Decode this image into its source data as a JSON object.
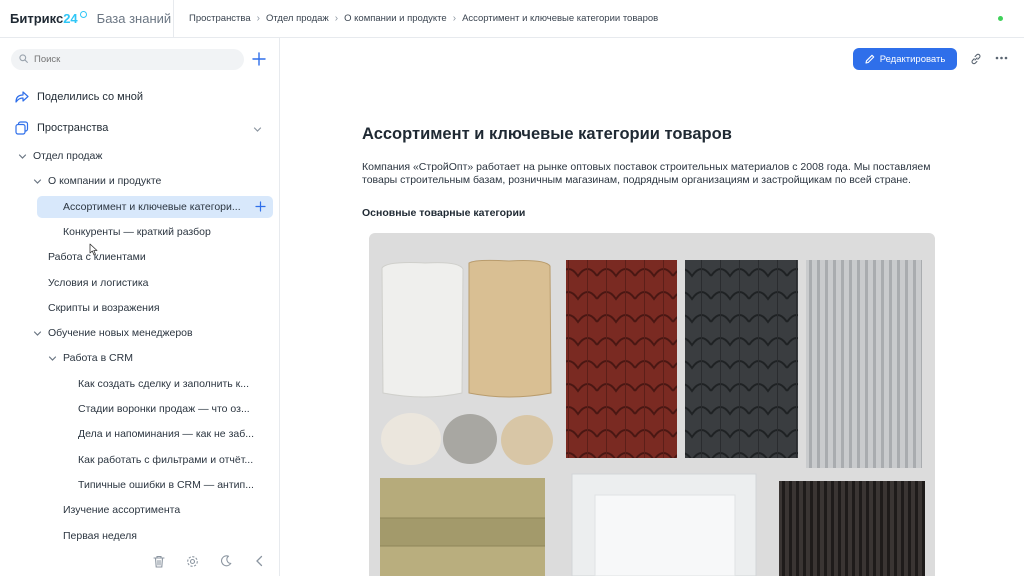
{
  "brand": {
    "name": "Битрикс",
    "number": "24",
    "section": "База знаний"
  },
  "breadcrumb": [
    "Пространства",
    "Отдел продаж",
    "О компании и продукте",
    "Ассортимент и ключевые категории товаров"
  ],
  "colors": {
    "accent": "#2f6fea",
    "active_row": "#d8e8fb",
    "online": "#3fd15a",
    "brand_blue": "#2fc6f6"
  },
  "sidebar": {
    "search_placeholder": "Поиск",
    "shared_label": "Поделились со мной",
    "spaces_label": "Пространства",
    "tree": [
      {
        "label": "Отдел продаж",
        "level": 0,
        "expanded": true
      },
      {
        "label": "О компании и продукте",
        "level": 1,
        "expanded": true
      },
      {
        "label": "Ассортимент и ключевые категори...",
        "level": 2,
        "active": true
      },
      {
        "label": "Конкуренты — краткий разбор",
        "level": 2
      },
      {
        "label": "Работа с клиентами",
        "level": 1
      },
      {
        "label": "Условия и логистика",
        "level": 1
      },
      {
        "label": "Скрипты и возражения",
        "level": 1
      },
      {
        "label": "Обучение новых менеджеров",
        "level": 1,
        "expanded": true
      },
      {
        "label": "Работа в CRM",
        "level": 2,
        "expanded": true
      },
      {
        "label": "Как создать сделку и заполнить к...",
        "level": 3
      },
      {
        "label": "Стадии воронки продаж — что оз...",
        "level": 3
      },
      {
        "label": "Дела и напоминания — как не заб...",
        "level": 3
      },
      {
        "label": "Как работать с фильтрами и отчёт...",
        "level": 3
      },
      {
        "label": "Типичные ошибки в CRM — антип...",
        "level": 3
      },
      {
        "label": "Изучение ассортимента",
        "level": 2
      },
      {
        "label": "Первая неделя",
        "level": 2
      }
    ],
    "footer_icons": [
      "trash-icon",
      "gear-icon",
      "moon-icon",
      "chevron-left-icon"
    ]
  },
  "toolbar": {
    "edit_label": "Редактировать"
  },
  "document": {
    "title": "Ассортимент и ключевые категории товаров",
    "intro": "Компания «СтройОпт» работает на рынке оптовых поставок строительных материалов с 2008 года. Мы поставляем товары строительным базам, розничным магазинам, подрядным организациям и застройщикам по всей стране.",
    "section_heading": "Основные товарные категории"
  }
}
